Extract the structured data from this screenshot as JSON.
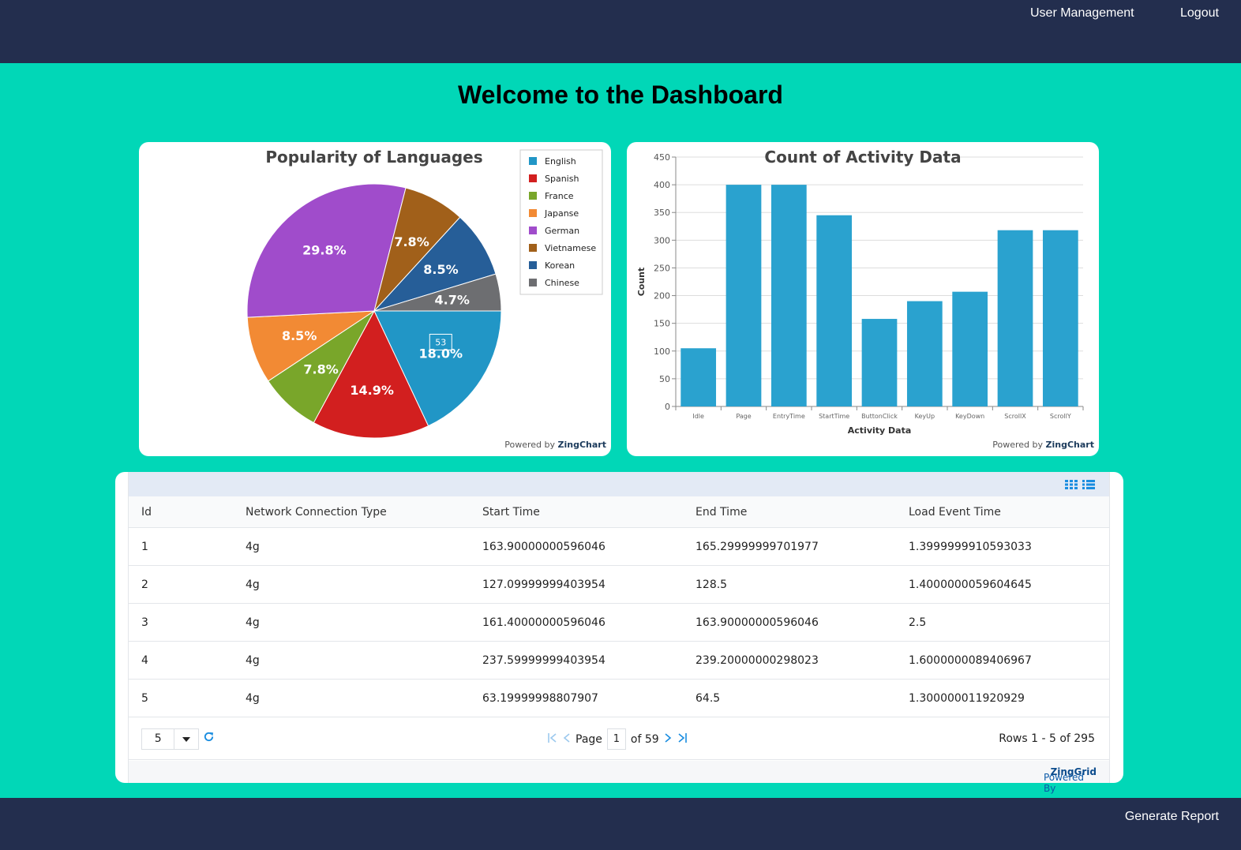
{
  "nav": {
    "user_management": "User Management",
    "logout": "Logout"
  },
  "page": {
    "title": "Welcome to the Dashboard"
  },
  "powered_chart": {
    "prefix": "Powered by ",
    "brand": "ZingChart"
  },
  "chart_data": [
    {
      "type": "pie",
      "title": "Popularity of Languages",
      "slices": [
        {
          "label": "English",
          "value": 18.0,
          "color": "#2196c6",
          "display": "18.0%"
        },
        {
          "label": "Spanish",
          "value": 14.9,
          "color": "#d21f1f",
          "display": "14.9%"
        },
        {
          "label": "France",
          "value": 7.8,
          "color": "#79a62a",
          "display": "7.8%"
        },
        {
          "label": "Japanse",
          "value": 8.5,
          "color": "#f28a34",
          "display": "8.5%"
        },
        {
          "label": "German",
          "value": 29.8,
          "color": "#a04ccb",
          "display": "29.8%"
        },
        {
          "label": "Vietnamese",
          "value": 7.8,
          "color": "#a1601a",
          "display": "7.8%"
        },
        {
          "label": "Korean",
          "value": 8.5,
          "color": "#265e98",
          "display": "8.5%"
        },
        {
          "label": "Chinese",
          "value": 4.7,
          "color": "#6d6e71",
          "display": "4.7%"
        }
      ],
      "tooltip": "53",
      "legend_position": "top-right"
    },
    {
      "type": "bar",
      "title": "Count of Activity Data",
      "categories": [
        "Idle",
        "Page",
        "EntryTime",
        "StartTime",
        "ButtonClick",
        "KeyUp",
        "KeyDown",
        "ScrollX",
        "ScrollY"
      ],
      "values": [
        105,
        400,
        400,
        345,
        158,
        190,
        207,
        318,
        318
      ],
      "xlabel": "Activity Data",
      "ylabel": "Count",
      "ylim": [
        0,
        450
      ],
      "yticks": [
        0,
        50,
        100,
        150,
        200,
        250,
        300,
        350,
        400,
        450
      ],
      "color": "#2aa2cf",
      "grid": true
    }
  ],
  "grid": {
    "columns": [
      "Id",
      "Network Connection Type",
      "Start Time",
      "End Time",
      "Load Event Time"
    ],
    "rows": [
      [
        "1",
        "4g",
        "163.90000000596046",
        "165.29999999701977",
        "1.3999999910593033"
      ],
      [
        "2",
        "4g",
        "127.09999999403954",
        "128.5",
        "1.4000000059604645"
      ],
      [
        "3",
        "4g",
        "161.40000000596046",
        "163.90000000596046",
        "2.5"
      ],
      [
        "4",
        "4g",
        "237.59999999403954",
        "239.20000000298023",
        "1.6000000089406967"
      ],
      [
        "5",
        "4g",
        "63.19999998807907",
        "64.5",
        "1.300000011920929"
      ]
    ],
    "page_size": "5",
    "page_label": "Page",
    "page_number": "1",
    "page_total": "of 59",
    "rows_info": "Rows 1 - 5 of 295",
    "powered_prefix": "Powered By ",
    "powered_brand": "ZingGrid"
  },
  "footer": {
    "generate_report": "Generate Report"
  }
}
